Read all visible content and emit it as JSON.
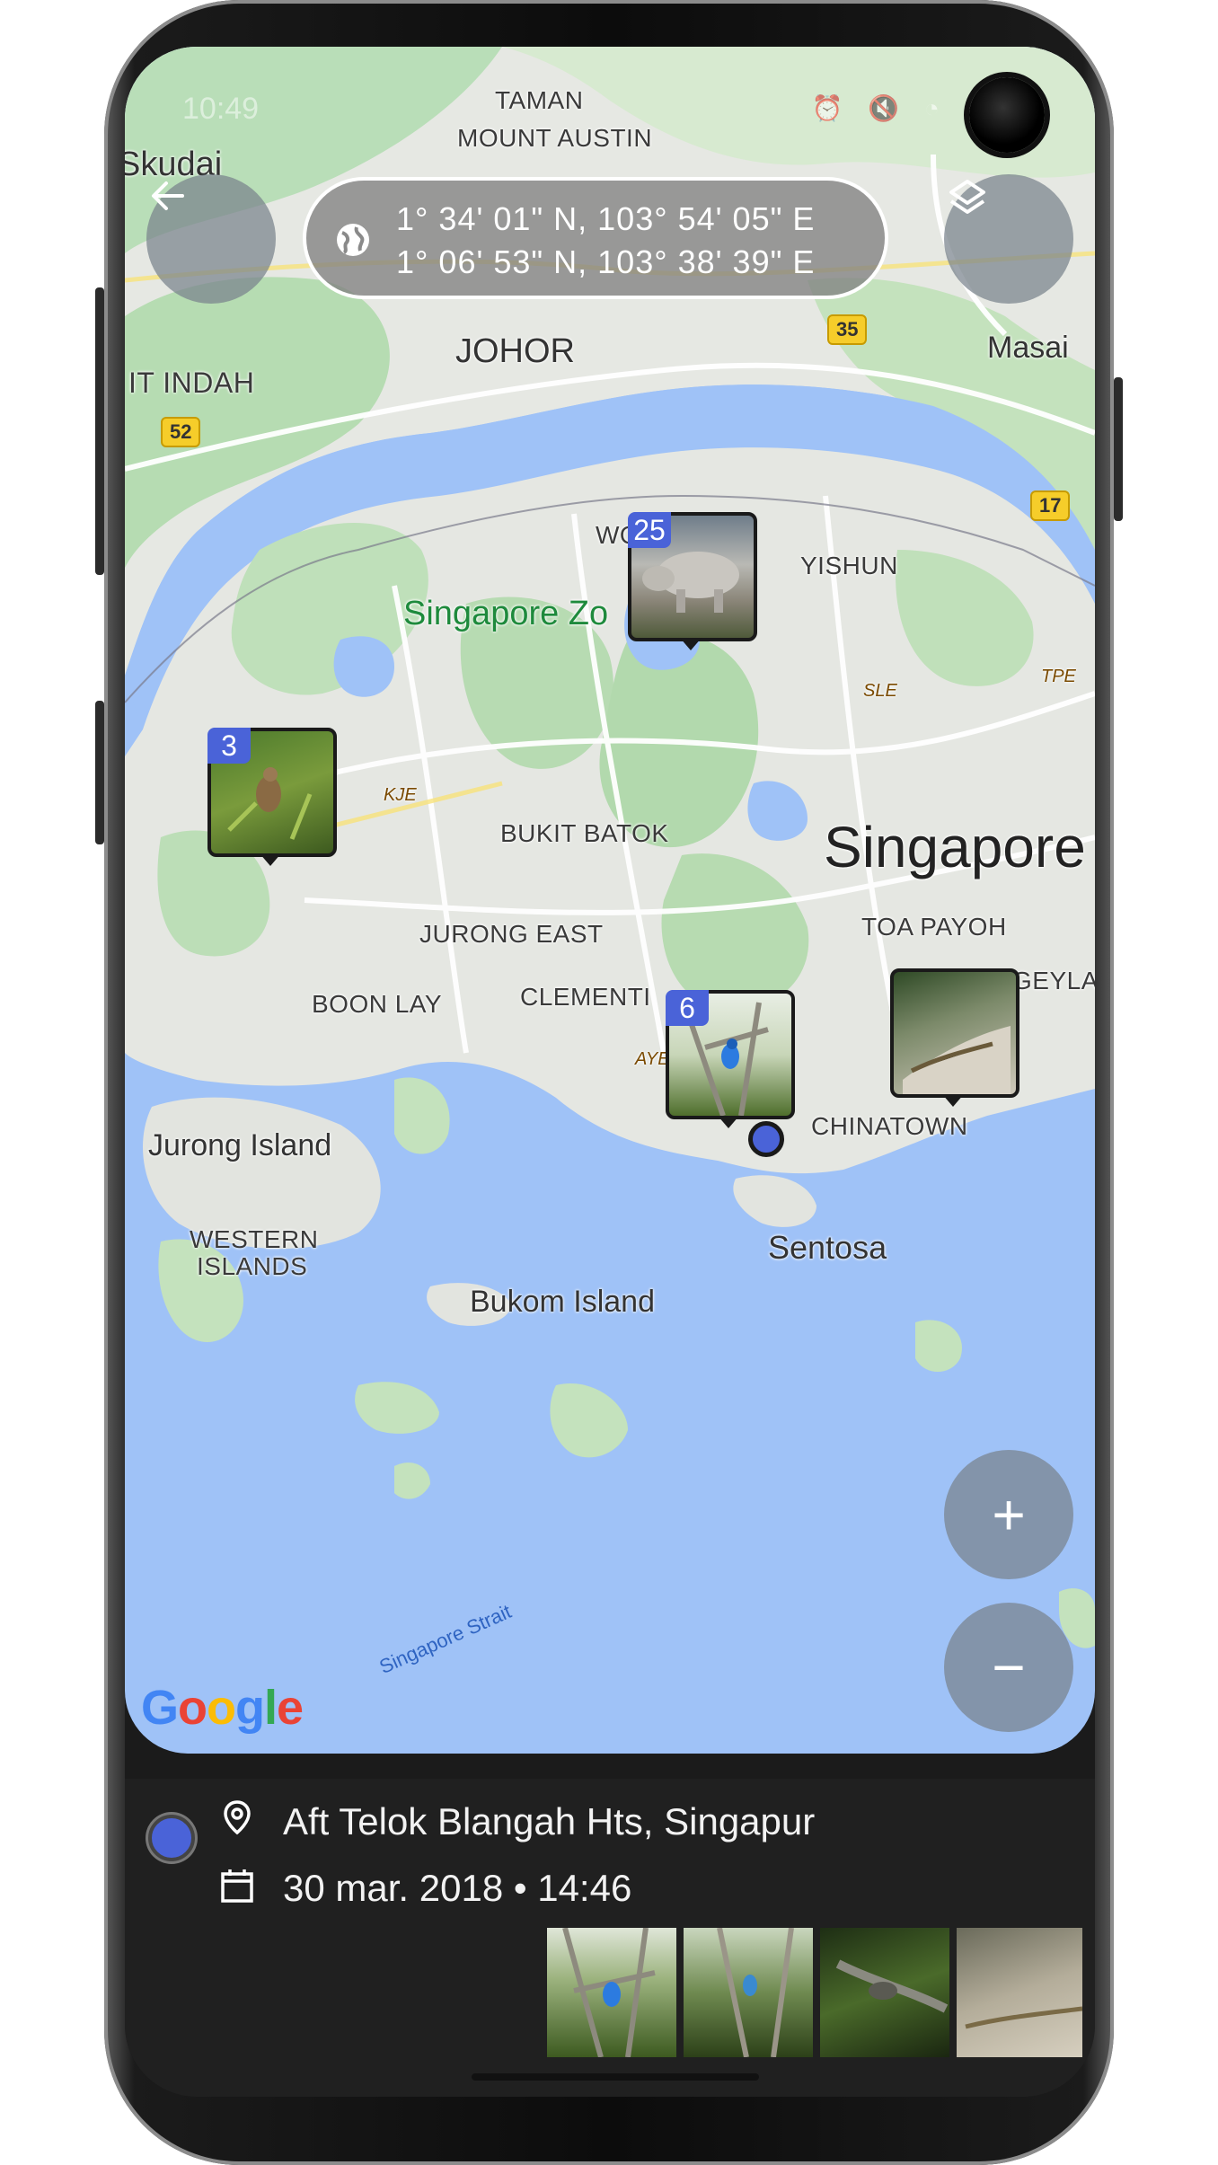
{
  "status_bar": {
    "time": "10:49"
  },
  "map": {
    "coords": {
      "line1": "1° 34' 01\" N, 103° 54' 05\" E",
      "line2": "1° 06' 53\" N, 103° 38' 39\" E"
    },
    "labels": {
      "taman": "TAMAN",
      "mount_austin": "MOUNT AUSTIN",
      "skudai": "Skudai",
      "johor": "JOHOR",
      "masai": "Masai",
      "it_indah": "IT INDAH",
      "wo": "WO",
      "yishun": "YISHUN",
      "singapore_zoo": "Singapore Zo",
      "bukit_batok": "BUKIT BATOK",
      "singapore": "Singapore",
      "toa_payoh": "TOA PAYOH",
      "jurong_east": "JURONG EAST",
      "boon_lay": "BOON LAY",
      "clementi": "CLEMENTI",
      "geylang": "GEYLAN",
      "chinatown": "CHINATOWN",
      "jurong_island": "Jurong Island",
      "western_islands_1": "WESTERN",
      "western_islands_2": "ISLANDS",
      "sentosa": "Sentosa",
      "bukom_island": "Bukom Island",
      "singapore_strait": "Singapore Strait",
      "kje": "KJE",
      "sle": "SLE",
      "tpe": "TPE",
      "aye": "AYE"
    },
    "shields": {
      "s35": "35",
      "s52": "52",
      "s17": "17"
    },
    "markers": [
      {
        "count": "25",
        "subject": "rhino"
      },
      {
        "count": "3",
        "subject": "bird-in-grass"
      },
      {
        "count": "6",
        "subject": "kingfisher"
      },
      {
        "count": "",
        "subject": "lizard"
      }
    ],
    "google_logo": {
      "text": "Google",
      "colors": [
        "#4285F4",
        "#EA4335",
        "#FBBC05",
        "#4285F4",
        "#34A853",
        "#EA4335"
      ]
    },
    "buttons": {
      "zoom_in": "+",
      "zoom_out": "−"
    }
  },
  "info": {
    "location": "Aft Telok Blangah Hts, Singapur",
    "date": "30 mar. 2018 • 14:46",
    "accent": "#4a63d8"
  }
}
